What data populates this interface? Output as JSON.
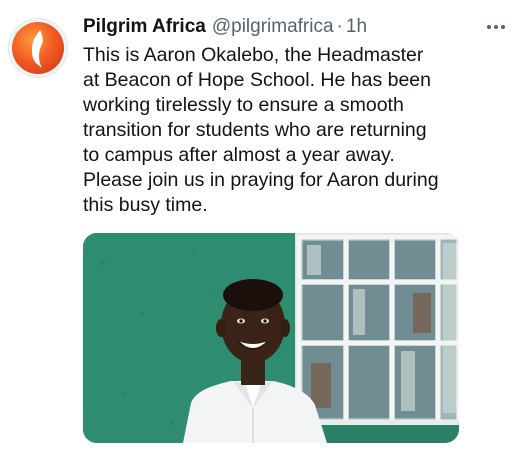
{
  "tweet": {
    "display_name": "Pilgrim Africa",
    "handle": "@pilgrimafrica",
    "separator": "·",
    "time": "1h",
    "text": "This is Aaron Okalebo, the Headmaster\nat Beacon of Hope School. He has been\nworking tirelessly to ensure a smooth\ntransition for students who are returning\nto campus after almost a year away.\nPlease join us in praying for Aaron during\nthis busy time."
  },
  "icons": {
    "avatar": "pilgrim-africa-flame-logo",
    "more": "more-horizontal-icon"
  },
  "colors": {
    "name_text": "#0f1419",
    "secondary_text": "#536471",
    "logo_orange": "#f15a24",
    "wall_green": "#2f8a6e"
  }
}
